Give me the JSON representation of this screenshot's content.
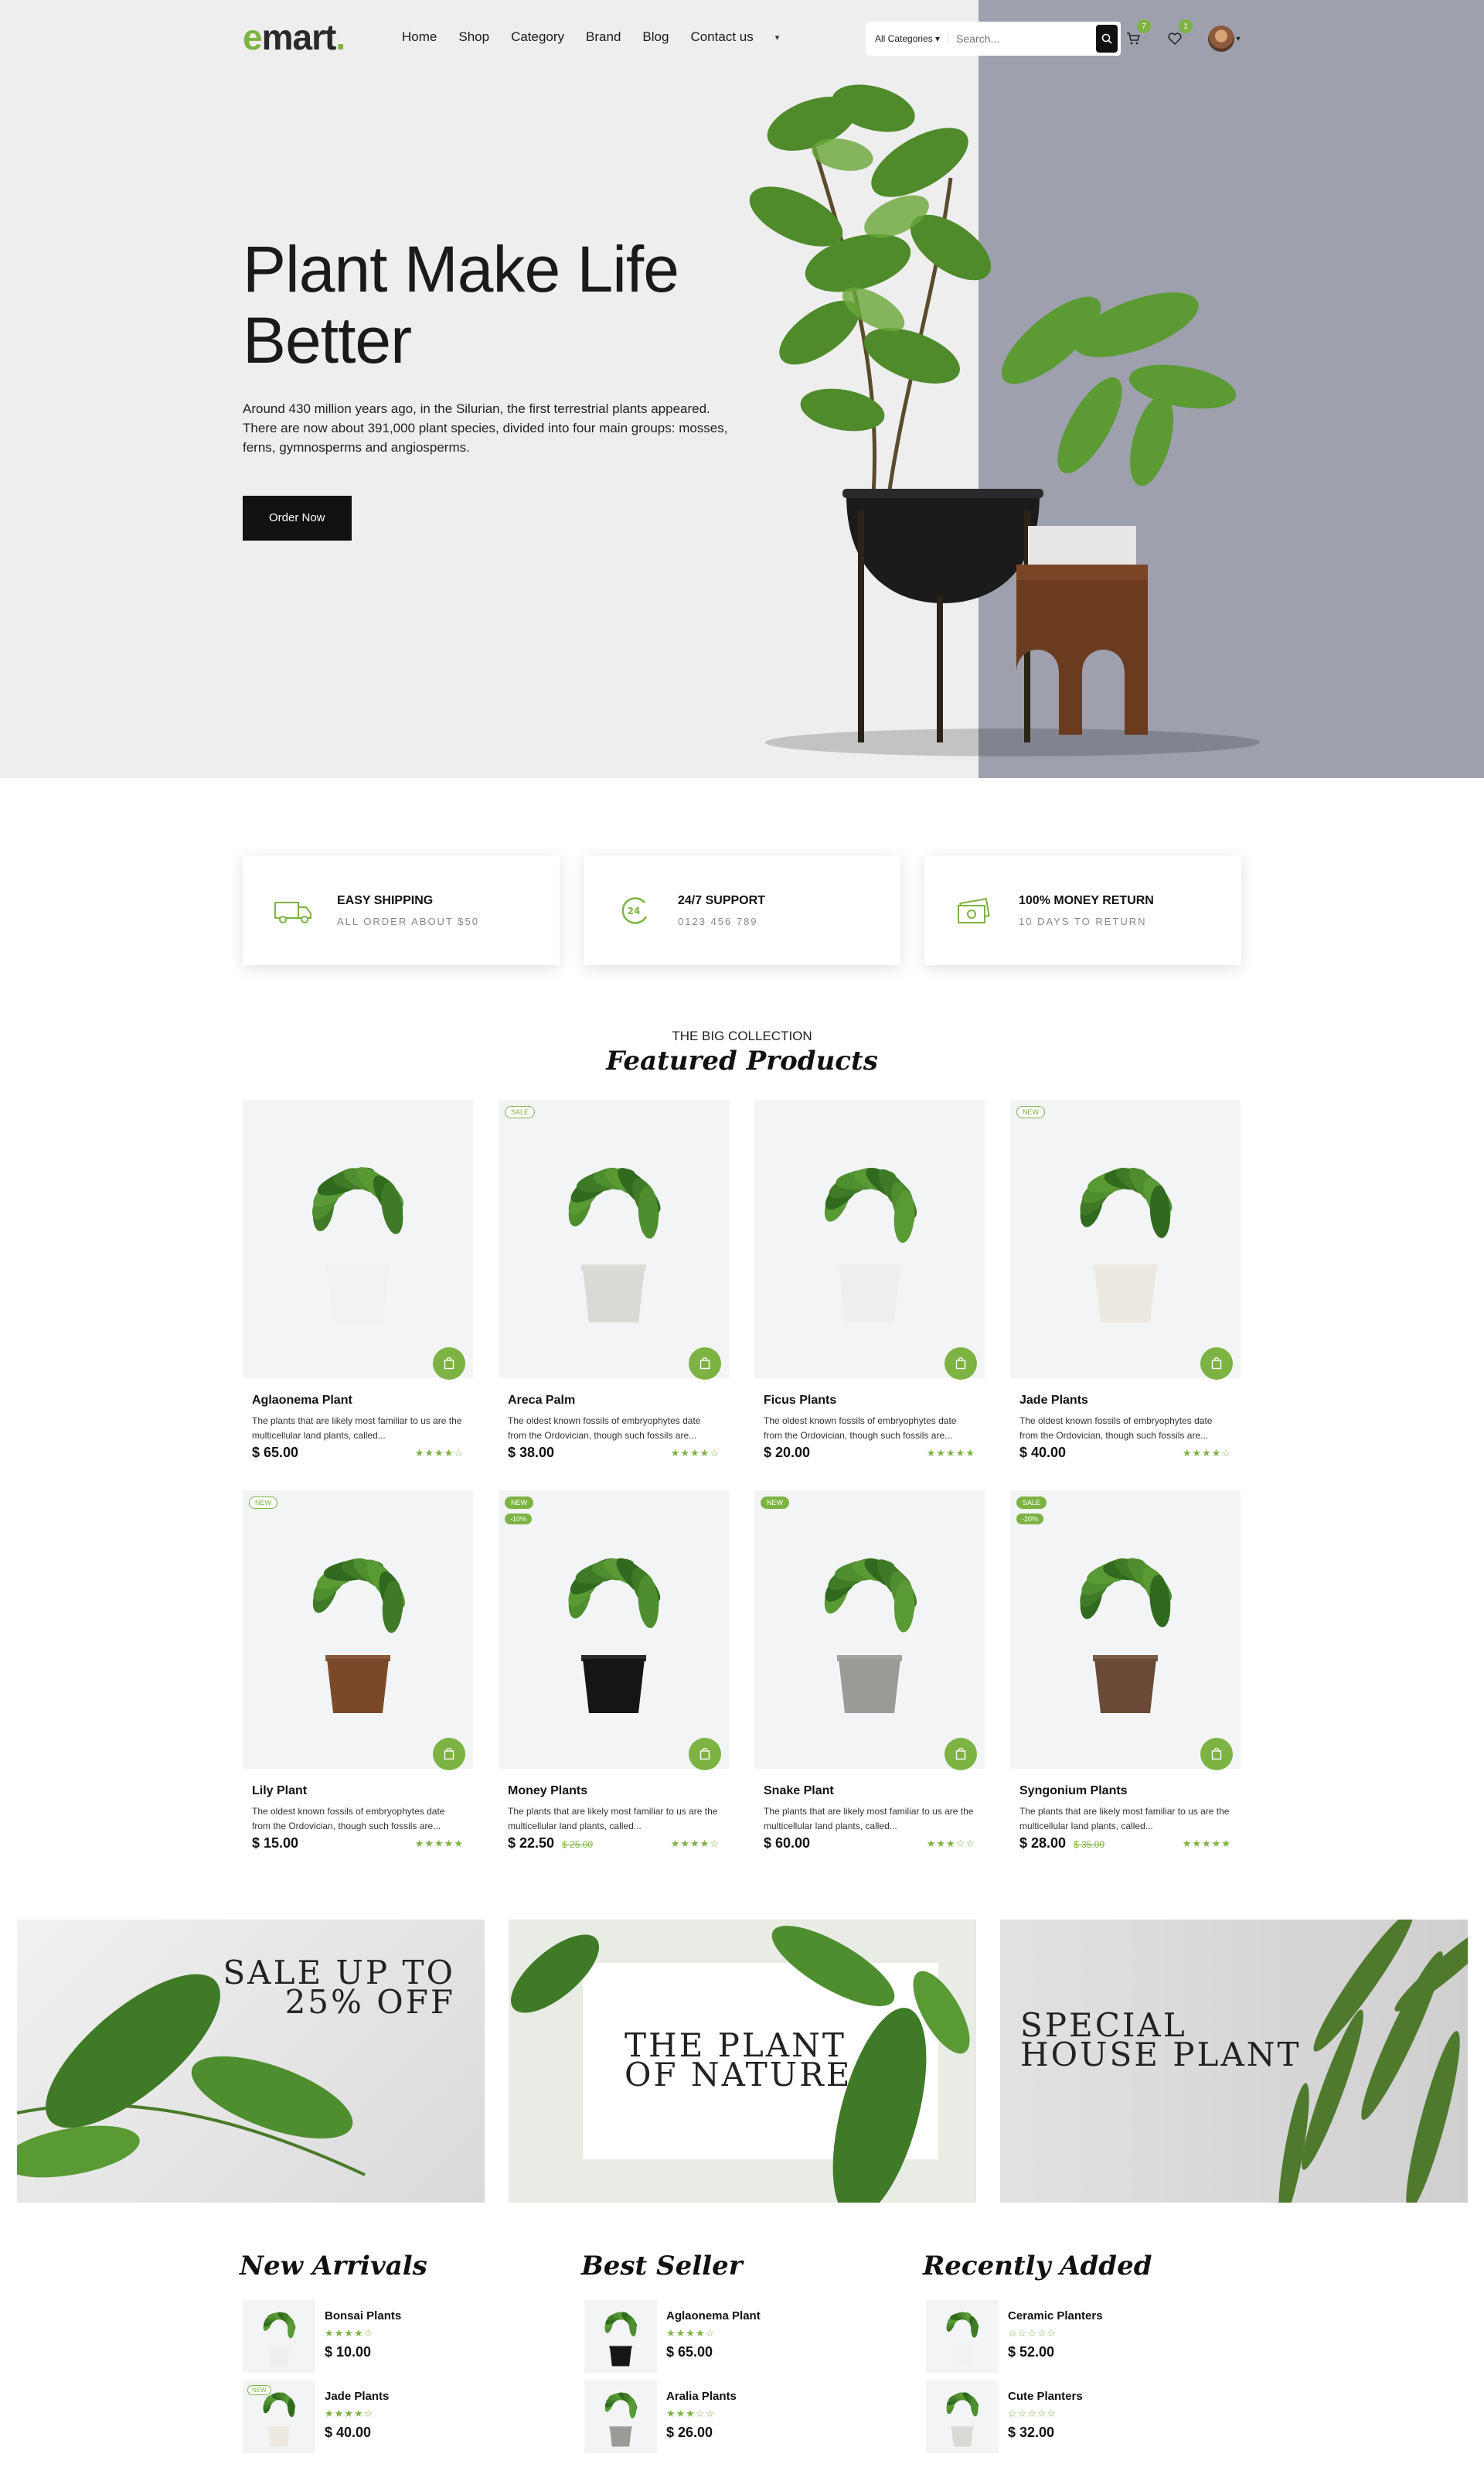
{
  "header": {
    "logo_e": "e",
    "logo_rest": "mart",
    "nav": [
      "Home",
      "Shop",
      "Category",
      "Brand",
      "Blog",
      "Contact us"
    ],
    "search": {
      "category": "All Categories",
      "placeholder": "Search..."
    },
    "cart_count": "7",
    "wishlist_count": "1"
  },
  "hero": {
    "title": "Plant Make Life Better",
    "description": "Around 430 million years ago, in the Silurian, the first terrestrial plants appeared. There are now about 391,000 plant species, divided into four main groups: mosses, ferns, gymnosperms and angiosperms.",
    "button": "Order Now"
  },
  "features": [
    {
      "title": "EASY SHIPPING",
      "subtitle": "ALL ORDER ABOUT $50",
      "icon": "truck-icon"
    },
    {
      "title": "24/7 SUPPORT",
      "subtitle": "0123 456 789",
      "icon": "support-24-icon"
    },
    {
      "title": "100% MONEY RETURN",
      "subtitle": "10 DAYS TO RETURN",
      "icon": "money-icon"
    }
  ],
  "featured": {
    "small_title": "THE BIG COLLECTION",
    "script_title": "Featured Products",
    "products": [
      {
        "name": "Aglaonema Plant",
        "desc": "The plants that are likely most familiar to us are the multicellular land plants, called...",
        "price": "$ 65.00",
        "old": "",
        "tag": "",
        "tag2": "",
        "rating": 4
      },
      {
        "name": "Areca Palm",
        "desc": "The oldest known fossils of embryophytes date from the Ordovician, though such fossils are...",
        "price": "$ 38.00",
        "old": "",
        "tag": "SALE",
        "tag2": "",
        "rating": 4
      },
      {
        "name": "Ficus Plants",
        "desc": "The oldest known fossils of embryophytes date from the Ordovician, though such fossils are...",
        "price": "$ 20.00",
        "old": "",
        "tag": "",
        "tag2": "",
        "rating": 5
      },
      {
        "name": "Jade Plants",
        "desc": "The oldest known fossils of embryophytes date from the Ordovician, though such fossils are...",
        "price": "$ 40.00",
        "old": "",
        "tag": "NEW",
        "tag2": "",
        "rating": 4
      },
      {
        "name": "Lily Plant",
        "desc": "The oldest known fossils of embryophytes date from the Ordovician, though such fossils are...",
        "price": "$ 15.00",
        "old": "",
        "tag": "NEW",
        "tag2": "",
        "rating": 5
      },
      {
        "name": "Money Plants",
        "desc": "The plants that are likely most familiar to us are the multicellular land plants, called...",
        "price": "$ 22.50",
        "old": "$ 25.00",
        "tag": "NEW",
        "tag2": "-10%",
        "rating": 3.5
      },
      {
        "name": "Snake Plant",
        "desc": "The plants that are likely most familiar to us are the multicellular land plants, called...",
        "price": "$ 60.00",
        "old": "",
        "tag": "NEW",
        "tag2": "",
        "rating": 3
      },
      {
        "name": "Syngonium Plants",
        "desc": "The plants that are likely most familiar to us are the multicellular land plants, called...",
        "price": "$ 28.00",
        "old": "$ 35.00",
        "tag": "SALE",
        "tag2": "-20%",
        "rating": 5
      }
    ]
  },
  "banners": [
    {
      "line1": "Sale up to",
      "line2": "25% Off"
    },
    {
      "line1": "The plant",
      "line2": "of Nature"
    },
    {
      "line1": "Special",
      "line2": "House Plant"
    }
  ],
  "lists": [
    {
      "title": "New Arrivals",
      "items": [
        {
          "name": "Bonsai Plants",
          "price": "$ 10.00",
          "rating": 4,
          "tag": ""
        },
        {
          "name": "Jade Plants",
          "price": "$ 40.00",
          "rating": 4,
          "tag": "NEW"
        }
      ]
    },
    {
      "title": "Best Seller",
      "items": [
        {
          "name": "Aglaonema Plant",
          "price": "$ 65.00",
          "rating": 4,
          "tag": ""
        },
        {
          "name": "Aralia Plants",
          "price": "$ 26.00",
          "rating": 3,
          "tag": ""
        }
      ]
    },
    {
      "title": "Recently Added",
      "items": [
        {
          "name": "Ceramic Planters",
          "price": "$ 52.00",
          "rating": 0,
          "tag": ""
        },
        {
          "name": "Cute Planters",
          "price": "$ 32.00",
          "rating": 0,
          "tag": ""
        }
      ]
    }
  ],
  "colors": {
    "accent": "#7cb342",
    "hero_panel": "#9ea0ae"
  }
}
